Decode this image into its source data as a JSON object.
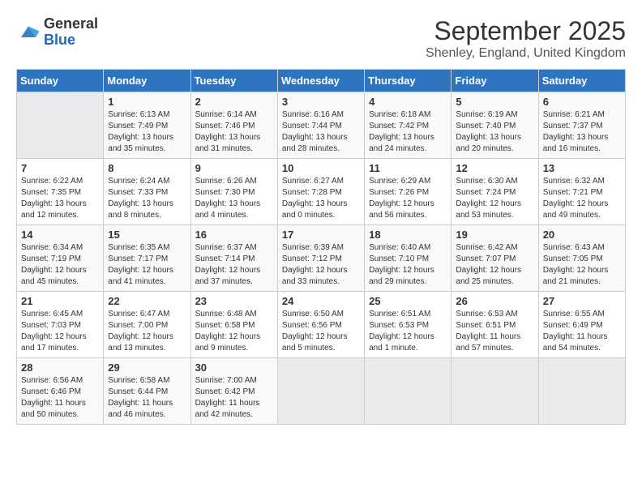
{
  "header": {
    "logo": {
      "general": "General",
      "blue": "Blue"
    },
    "title": "September 2025",
    "subtitle": "Shenley, England, United Kingdom"
  },
  "calendar": {
    "days": [
      "Sunday",
      "Monday",
      "Tuesday",
      "Wednesday",
      "Thursday",
      "Friday",
      "Saturday"
    ],
    "weeks": [
      [
        {
          "day": "",
          "info": ""
        },
        {
          "day": "1",
          "info": "Sunrise: 6:13 AM\nSunset: 7:49 PM\nDaylight: 13 hours\nand 35 minutes."
        },
        {
          "day": "2",
          "info": "Sunrise: 6:14 AM\nSunset: 7:46 PM\nDaylight: 13 hours\nand 31 minutes."
        },
        {
          "day": "3",
          "info": "Sunrise: 6:16 AM\nSunset: 7:44 PM\nDaylight: 13 hours\nand 28 minutes."
        },
        {
          "day": "4",
          "info": "Sunrise: 6:18 AM\nSunset: 7:42 PM\nDaylight: 13 hours\nand 24 minutes."
        },
        {
          "day": "5",
          "info": "Sunrise: 6:19 AM\nSunset: 7:40 PM\nDaylight: 13 hours\nand 20 minutes."
        },
        {
          "day": "6",
          "info": "Sunrise: 6:21 AM\nSunset: 7:37 PM\nDaylight: 13 hours\nand 16 minutes."
        }
      ],
      [
        {
          "day": "7",
          "info": "Sunrise: 6:22 AM\nSunset: 7:35 PM\nDaylight: 13 hours\nand 12 minutes."
        },
        {
          "day": "8",
          "info": "Sunrise: 6:24 AM\nSunset: 7:33 PM\nDaylight: 13 hours\nand 8 minutes."
        },
        {
          "day": "9",
          "info": "Sunrise: 6:26 AM\nSunset: 7:30 PM\nDaylight: 13 hours\nand 4 minutes."
        },
        {
          "day": "10",
          "info": "Sunrise: 6:27 AM\nSunset: 7:28 PM\nDaylight: 13 hours\nand 0 minutes."
        },
        {
          "day": "11",
          "info": "Sunrise: 6:29 AM\nSunset: 7:26 PM\nDaylight: 12 hours\nand 56 minutes."
        },
        {
          "day": "12",
          "info": "Sunrise: 6:30 AM\nSunset: 7:24 PM\nDaylight: 12 hours\nand 53 minutes."
        },
        {
          "day": "13",
          "info": "Sunrise: 6:32 AM\nSunset: 7:21 PM\nDaylight: 12 hours\nand 49 minutes."
        }
      ],
      [
        {
          "day": "14",
          "info": "Sunrise: 6:34 AM\nSunset: 7:19 PM\nDaylight: 12 hours\nand 45 minutes."
        },
        {
          "day": "15",
          "info": "Sunrise: 6:35 AM\nSunset: 7:17 PM\nDaylight: 12 hours\nand 41 minutes."
        },
        {
          "day": "16",
          "info": "Sunrise: 6:37 AM\nSunset: 7:14 PM\nDaylight: 12 hours\nand 37 minutes."
        },
        {
          "day": "17",
          "info": "Sunrise: 6:39 AM\nSunset: 7:12 PM\nDaylight: 12 hours\nand 33 minutes."
        },
        {
          "day": "18",
          "info": "Sunrise: 6:40 AM\nSunset: 7:10 PM\nDaylight: 12 hours\nand 29 minutes."
        },
        {
          "day": "19",
          "info": "Sunrise: 6:42 AM\nSunset: 7:07 PM\nDaylight: 12 hours\nand 25 minutes."
        },
        {
          "day": "20",
          "info": "Sunrise: 6:43 AM\nSunset: 7:05 PM\nDaylight: 12 hours\nand 21 minutes."
        }
      ],
      [
        {
          "day": "21",
          "info": "Sunrise: 6:45 AM\nSunset: 7:03 PM\nDaylight: 12 hours\nand 17 minutes."
        },
        {
          "day": "22",
          "info": "Sunrise: 6:47 AM\nSunset: 7:00 PM\nDaylight: 12 hours\nand 13 minutes."
        },
        {
          "day": "23",
          "info": "Sunrise: 6:48 AM\nSunset: 6:58 PM\nDaylight: 12 hours\nand 9 minutes."
        },
        {
          "day": "24",
          "info": "Sunrise: 6:50 AM\nSunset: 6:56 PM\nDaylight: 12 hours\nand 5 minutes."
        },
        {
          "day": "25",
          "info": "Sunrise: 6:51 AM\nSunset: 6:53 PM\nDaylight: 12 hours\nand 1 minute."
        },
        {
          "day": "26",
          "info": "Sunrise: 6:53 AM\nSunset: 6:51 PM\nDaylight: 11 hours\nand 57 minutes."
        },
        {
          "day": "27",
          "info": "Sunrise: 6:55 AM\nSunset: 6:49 PM\nDaylight: 11 hours\nand 54 minutes."
        }
      ],
      [
        {
          "day": "28",
          "info": "Sunrise: 6:56 AM\nSunset: 6:46 PM\nDaylight: 11 hours\nand 50 minutes."
        },
        {
          "day": "29",
          "info": "Sunrise: 6:58 AM\nSunset: 6:44 PM\nDaylight: 11 hours\nand 46 minutes."
        },
        {
          "day": "30",
          "info": "Sunrise: 7:00 AM\nSunset: 6:42 PM\nDaylight: 11 hours\nand 42 minutes."
        },
        {
          "day": "",
          "info": ""
        },
        {
          "day": "",
          "info": ""
        },
        {
          "day": "",
          "info": ""
        },
        {
          "day": "",
          "info": ""
        }
      ]
    ]
  }
}
